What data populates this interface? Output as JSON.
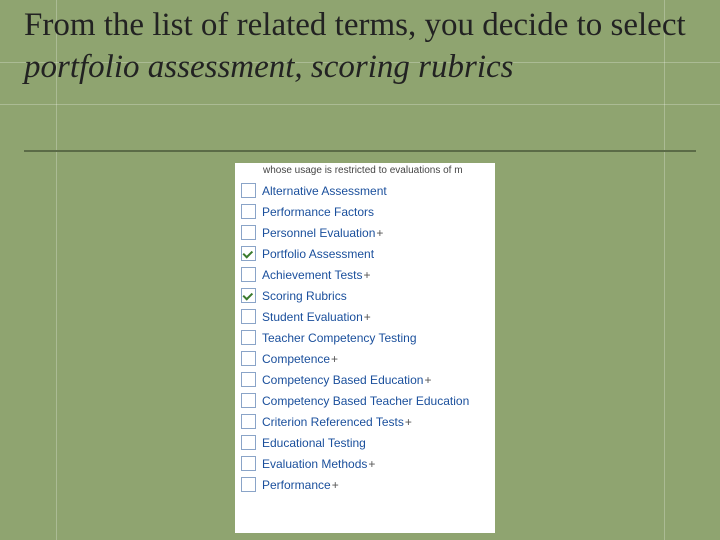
{
  "title": {
    "plain": "From the list of related terms, you decide to select ",
    "italic": "portfolio assessment, scoring rubrics"
  },
  "snippet_text": "whose usage is restricted to evaluations of m",
  "terms": [
    {
      "label": "Alternative Assessment",
      "checked": false,
      "expandable": false
    },
    {
      "label": "Performance Factors",
      "checked": false,
      "expandable": false
    },
    {
      "label": "Personnel Evaluation",
      "checked": false,
      "expandable": true
    },
    {
      "label": "Portfolio Assessment",
      "checked": true,
      "expandable": false
    },
    {
      "label": "Achievement Tests",
      "checked": false,
      "expandable": true
    },
    {
      "label": "Scoring Rubrics",
      "checked": true,
      "expandable": false
    },
    {
      "label": "Student Evaluation",
      "checked": false,
      "expandable": true
    },
    {
      "label": "Teacher Competency Testing",
      "checked": false,
      "expandable": false
    },
    {
      "label": "Competence",
      "checked": false,
      "expandable": true
    },
    {
      "label": "Competency Based Education",
      "checked": false,
      "expandable": true
    },
    {
      "label": "Competency Based Teacher Education",
      "checked": false,
      "expandable": false
    },
    {
      "label": "Criterion Referenced Tests",
      "checked": false,
      "expandable": true
    },
    {
      "label": "Educational Testing",
      "checked": false,
      "expandable": false
    },
    {
      "label": "Evaluation Methods",
      "checked": false,
      "expandable": true
    },
    {
      "label": "Performance",
      "checked": false,
      "expandable": true
    }
  ],
  "colors": {
    "slide_bg": "#8fa470",
    "link": "#1a4f9c",
    "rule": "#5b6b47"
  }
}
